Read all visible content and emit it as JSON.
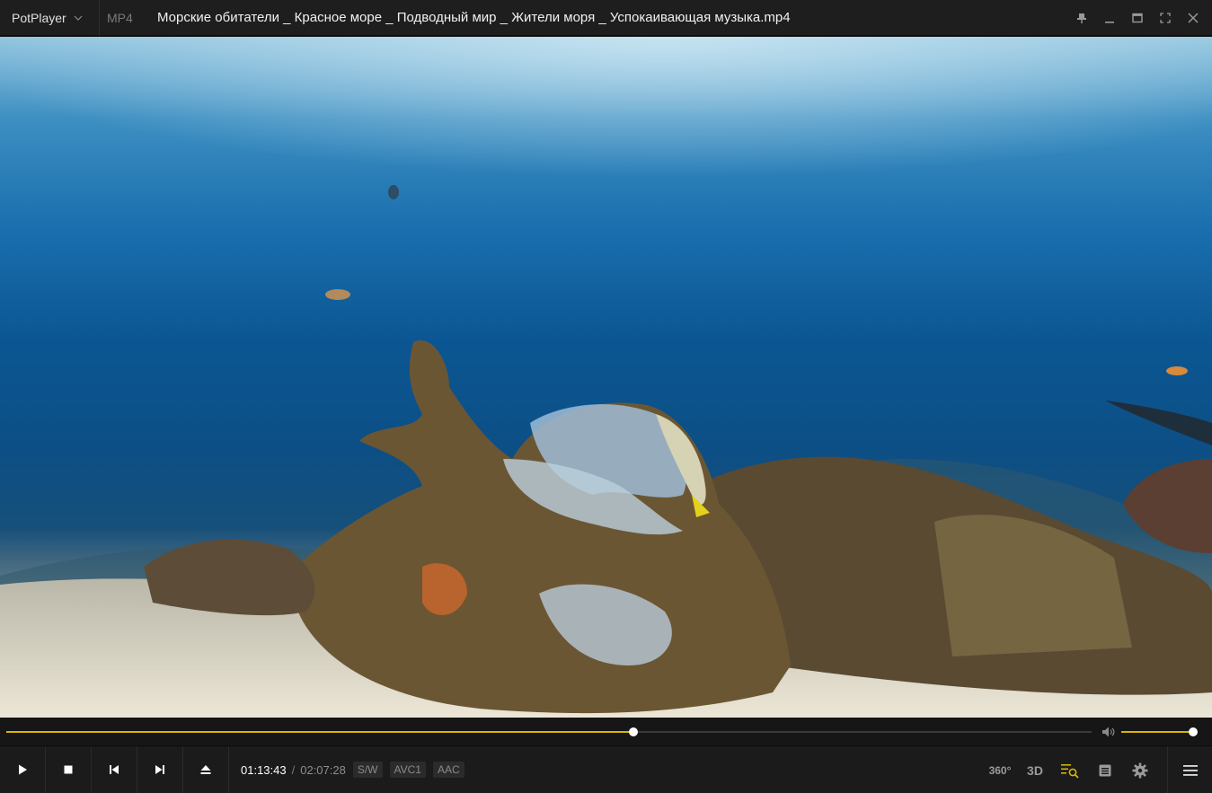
{
  "titlebar": {
    "app_name": "PotPlayer",
    "format": "MP4",
    "file_title": "Морские обитатели _ Красное море _ Подводный мир _ Жители моря _ Успокаивающая музыка.mp4"
  },
  "playback": {
    "current_time": "01:13:43",
    "separator": "/",
    "total_time": "02:07:28",
    "progress_fraction": 0.578,
    "volume_fraction": 0.98
  },
  "badges": {
    "renderer": "S/W",
    "video_codec": "AVC1",
    "audio_codec": "AAC"
  },
  "tools": {
    "vr": "360°",
    "stereo": "3D"
  },
  "icons": {
    "play": "play-icon",
    "stop": "stop-icon",
    "prev": "previous-icon",
    "next": "next-icon",
    "eject": "eject-icon",
    "pin": "pin-icon",
    "minimize": "minimize-icon",
    "maximize": "maximize-icon",
    "fullscreen": "fullscreen-icon",
    "close": "close-icon",
    "volume": "speaker-icon",
    "playlist": "playlist-search-icon",
    "chapter": "chapter-list-icon",
    "settings": "gear-icon",
    "menu": "hamburger-menu-icon"
  },
  "colors": {
    "accent": "#d8b500",
    "title_bg": "#1e1e1e",
    "controls_bg": "#1b1b1b"
  }
}
